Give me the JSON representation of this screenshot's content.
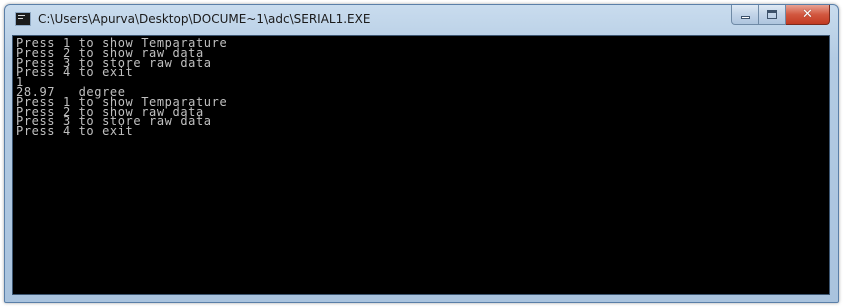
{
  "window": {
    "title": "C:\\Users\\Apurva\\Desktop\\DOCUME~1\\adc\\SERIAL1.EXE",
    "icon": "console-app-icon",
    "buttons": {
      "minimize_icon": "minimize-icon",
      "maximize_icon": "maximize-icon",
      "close_glyph": "✕"
    }
  },
  "console": {
    "background": "#000000",
    "text_color": "#c0c0c0",
    "lines": [
      "Press 1 to show Temparature",
      "Press 2 to show raw data",
      "Press 3 to store raw data",
      "Press 4 to exit",
      "1",
      "28.97   degree",
      "Press 1 to show Temparature",
      "Press 2 to show raw data",
      "Press 3 to store raw data",
      "Press 4 to exit"
    ]
  }
}
